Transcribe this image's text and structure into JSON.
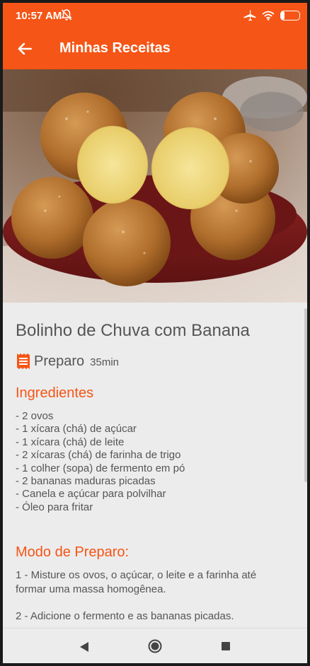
{
  "status_bar": {
    "time": "10:57 AM",
    "battery_level": "20",
    "battery_fraction": 0.2,
    "icons": [
      "notifications-off-icon",
      "airplane-icon",
      "wifi-icon",
      "battery-icon"
    ]
  },
  "app_bar": {
    "title": "Minhas Receitas",
    "back_icon": "arrow-back-icon"
  },
  "recipe": {
    "title": "Bolinho de Chuva com Banana",
    "prep_label": "Preparo",
    "prep_time": "35min",
    "ingredients_title": "Ingredientes",
    "ingredients": [
      "- 2 ovos",
      "- 1 xícara (chá) de açúcar",
      "- 1 xícara (chá) de leite",
      "- 2 xícaras (chá) de farinha de trigo",
      "- 1 colher (sopa) de fermento em pó",
      "- 2 bananas maduras picadas",
      "- Canela e açúcar para polvilhar",
      "- Óleo para fritar"
    ],
    "method_title": "Modo de Preparo:",
    "steps": [
      "1 - Misture os ovos, o açúcar, o leite e a farinha até formar uma massa homogênea.",
      "2 - Adicione o fermento e as bananas picadas."
    ]
  },
  "colors": {
    "accent": "#f55516",
    "text": "#555555",
    "background": "#ececec"
  },
  "nav_bar": {
    "icons": [
      "nav-back-icon",
      "nav-home-icon",
      "nav-recents-icon"
    ]
  }
}
